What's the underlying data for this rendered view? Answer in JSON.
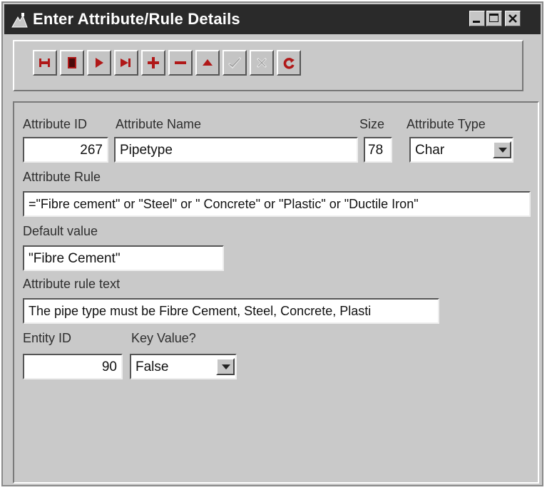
{
  "window": {
    "title": "Enter Attribute/Rule Details",
    "controls": [
      "minimize-icon",
      "maximize-icon",
      "close-icon"
    ]
  },
  "toolbar": {
    "buttons": [
      {
        "name": "first-record-icon",
        "glyph": "first"
      },
      {
        "name": "stop-icon",
        "glyph": "stop"
      },
      {
        "name": "next-record-icon",
        "glyph": "next"
      },
      {
        "name": "last-record-icon",
        "glyph": "last"
      },
      {
        "name": "add-record-icon",
        "glyph": "plus"
      },
      {
        "name": "delete-record-icon",
        "glyph": "minus"
      },
      {
        "name": "edit-record-icon",
        "glyph": "up"
      },
      {
        "name": "save-checkmark-icon",
        "glyph": "check",
        "disabled": true
      },
      {
        "name": "cancel-cross-icon",
        "glyph": "cross",
        "disabled": true
      },
      {
        "name": "refresh-icon",
        "glyph": "refresh"
      }
    ]
  },
  "form": {
    "attribute_id": {
      "label": "Attribute ID",
      "value": "267"
    },
    "attribute_name": {
      "label": "Attribute Name",
      "value": "Pipetype"
    },
    "size": {
      "label": "Size",
      "value": "78"
    },
    "attribute_type": {
      "label": "Attribute Type",
      "value": "Char"
    },
    "attribute_rule": {
      "label": "Attribute Rule",
      "value": "=\"Fibre cement\" or \"Steel\" or \" Concrete\" or \"Plastic\" or \"Ductile Iron\""
    },
    "default_value": {
      "label": "Default value",
      "value": "\"Fibre Cement\""
    },
    "attribute_rule_text": {
      "label": "Attribute rule text",
      "value": "The pipe type must be Fibre Cement, Steel, Concrete, Plasti"
    },
    "entity_id": {
      "label": "Entity ID",
      "value": "90"
    },
    "key_value": {
      "label": "Key Value?",
      "value": "False"
    }
  },
  "colors": {
    "titlebar": "#2a2a2a",
    "window_bg": "#c9c9c9",
    "field_bg": "#ffffff",
    "icon_red": "#b01818"
  }
}
